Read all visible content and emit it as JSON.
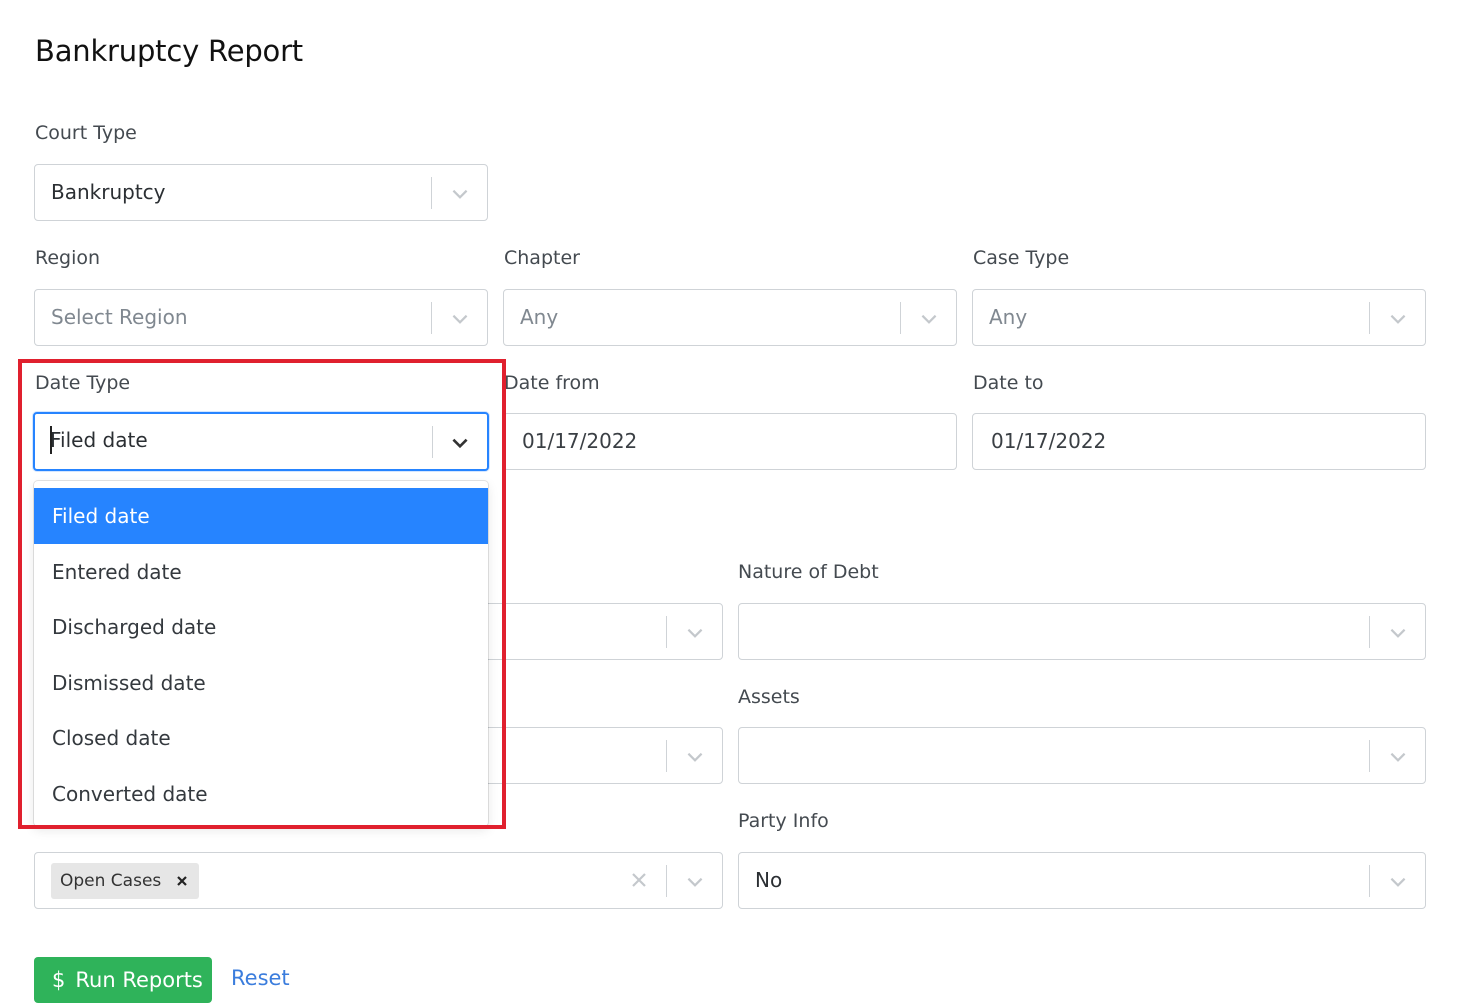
{
  "page": {
    "title": "Bankruptcy Report"
  },
  "fields": {
    "court_type": {
      "label": "Court Type",
      "value": "Bankruptcy"
    },
    "region": {
      "label": "Region",
      "placeholder": "Select Region"
    },
    "chapter": {
      "label": "Chapter",
      "value": "Any"
    },
    "case_type": {
      "label": "Case Type",
      "value": "Any"
    },
    "date_type": {
      "label": "Date Type",
      "value": "Filed date"
    },
    "date_from": {
      "label": "Date from",
      "value": "01/17/2022"
    },
    "date_to": {
      "label": "Date to",
      "value": "01/17/2022"
    },
    "nature_of_debt": {
      "label": "Nature of Debt",
      "value": ""
    },
    "assets": {
      "label": "Assets",
      "value": ""
    },
    "case_properties": {
      "tags": [
        "Open Cases"
      ]
    },
    "party_info": {
      "label": "Party Info",
      "value": "No"
    }
  },
  "date_type_menu": {
    "options": [
      "Filed date",
      "Entered date",
      "Discharged date",
      "Dismissed date",
      "Closed date",
      "Converted date"
    ],
    "selected": "Filed date"
  },
  "actions": {
    "run_label": "Run Reports",
    "run_icon": "$",
    "reset_label": "Reset"
  },
  "colors": {
    "focus": "#2684ff",
    "run_button": "#2fb35a",
    "link": "#3b7ddd",
    "highlight_box": "#e0202e"
  },
  "icons": [
    "chevron-down-icon",
    "close-icon",
    "dollar-icon"
  ]
}
